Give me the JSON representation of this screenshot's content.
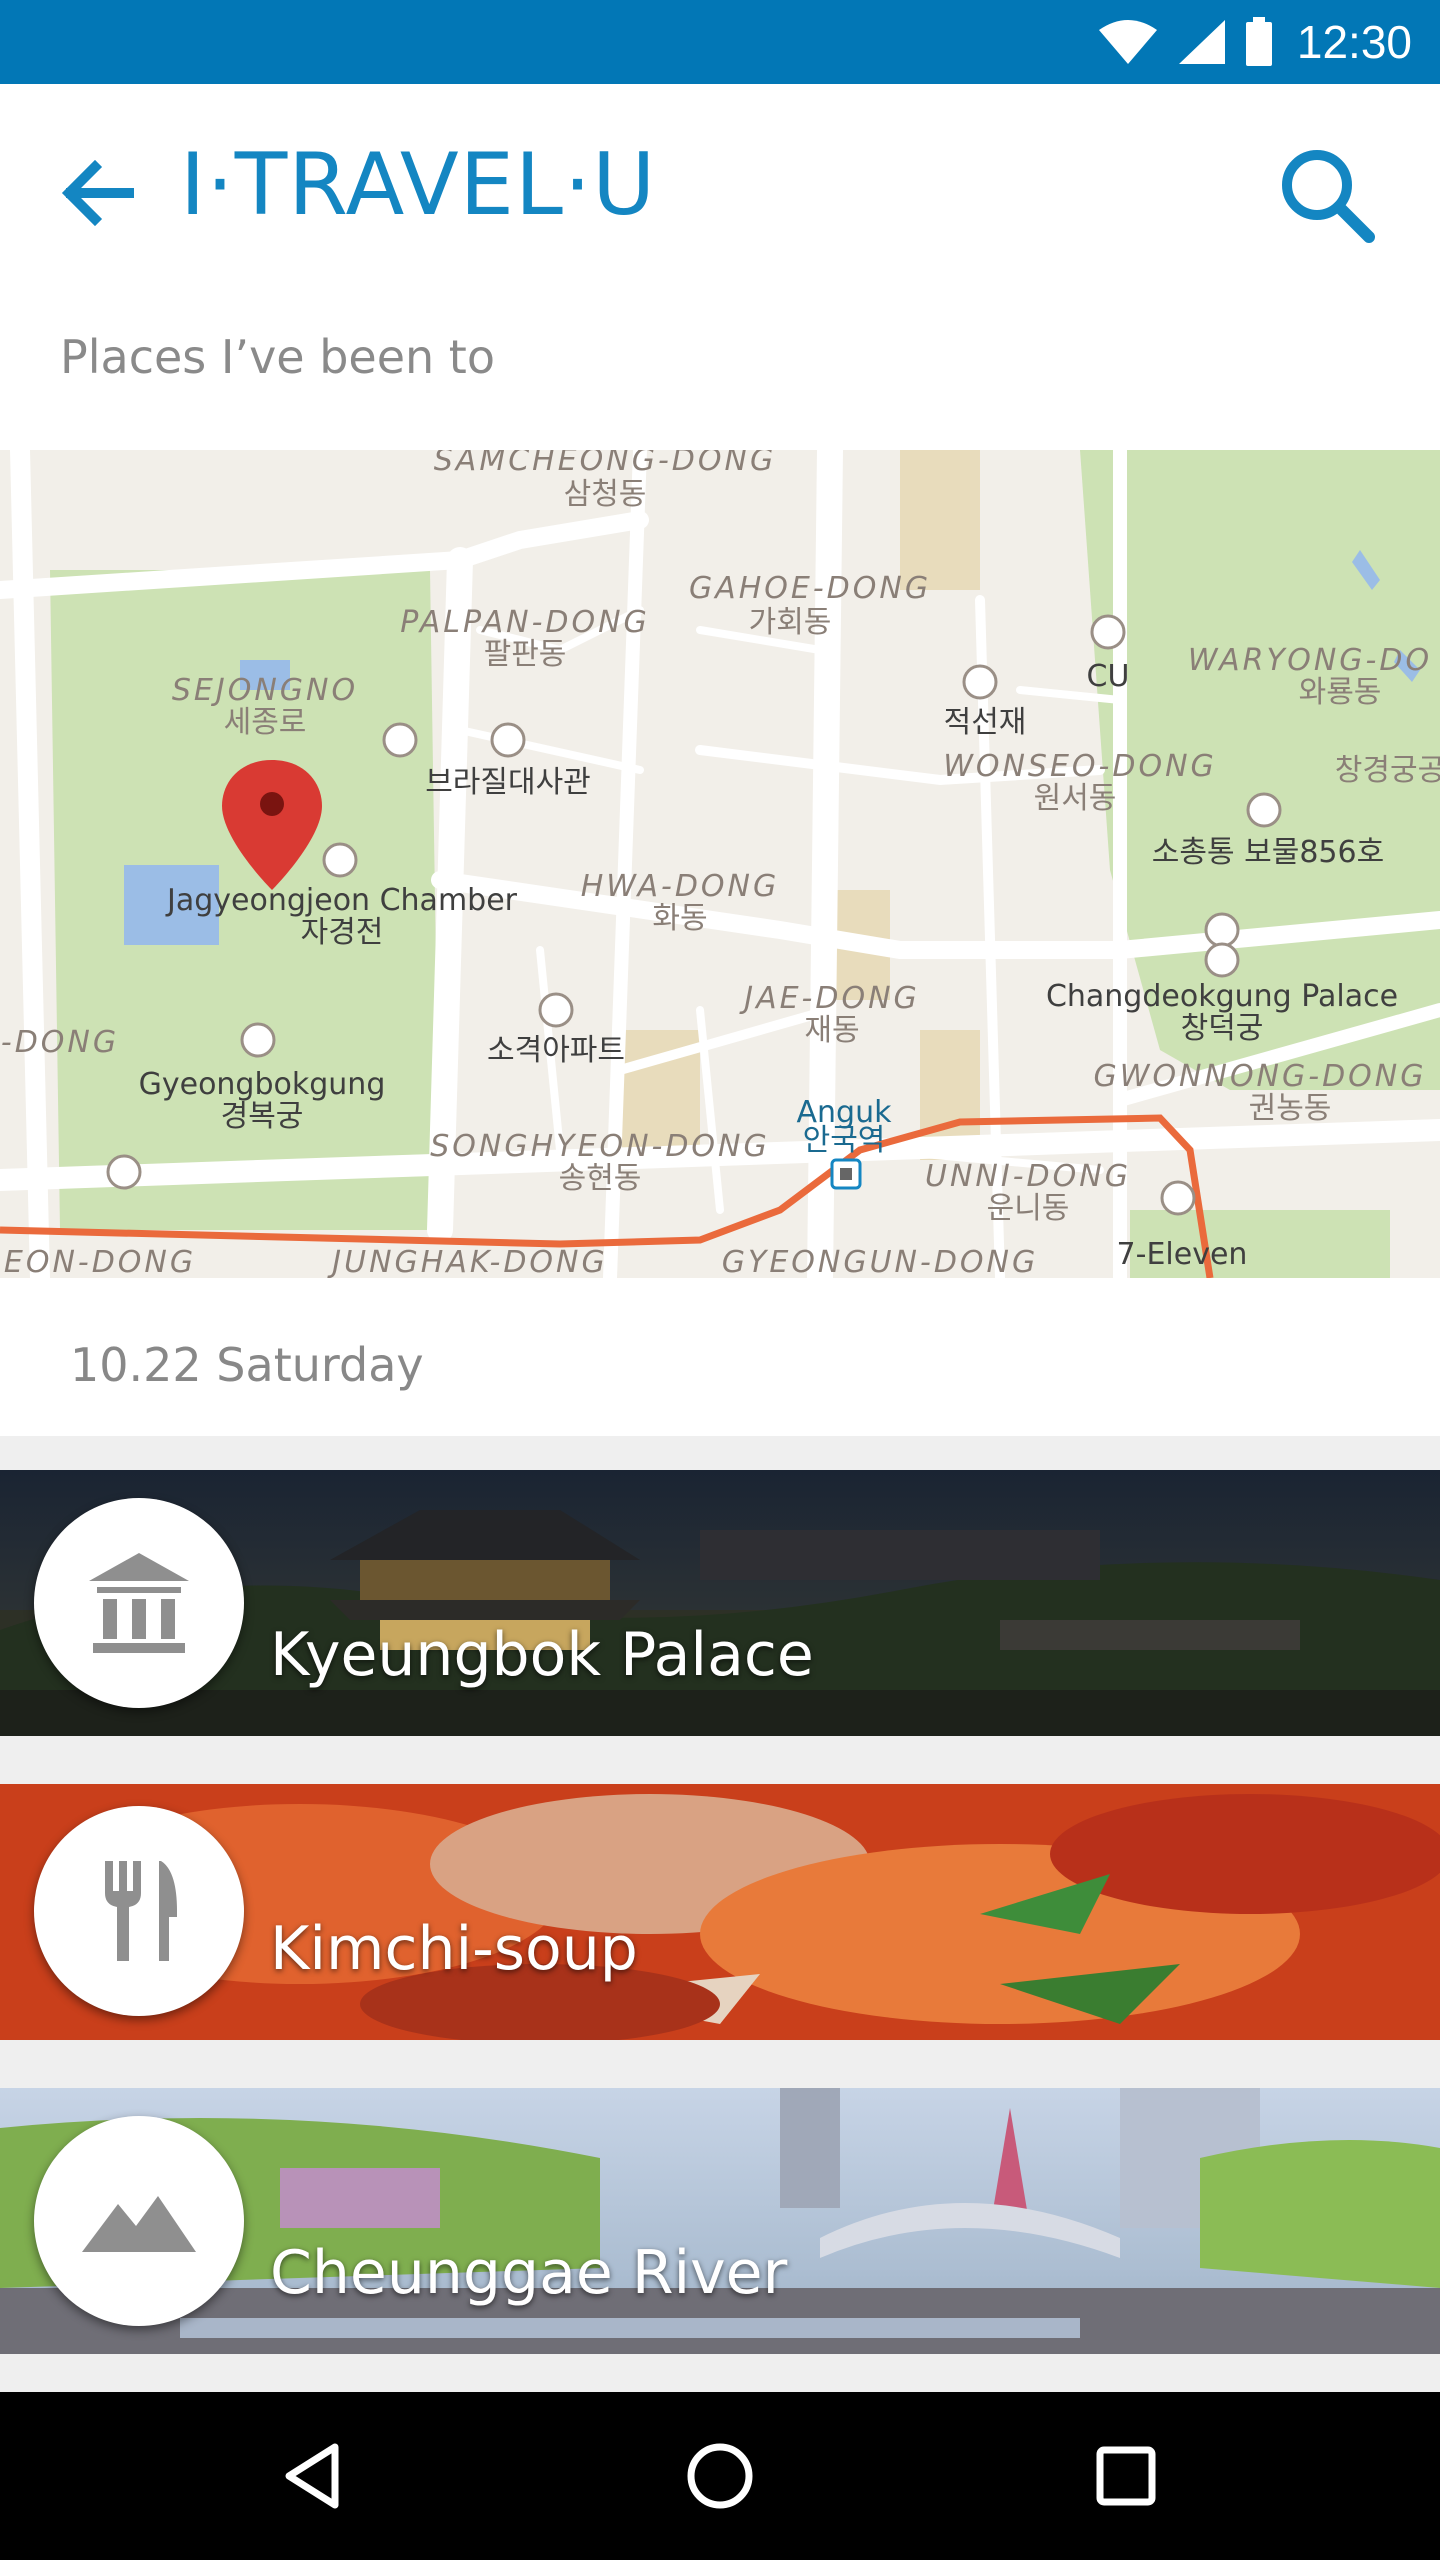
{
  "status_bar": {
    "time": "12:30",
    "bg_color": "#0277b6"
  },
  "app_bar": {
    "title": "I·TRAVEL·U",
    "back_icon": "arrow-back-icon",
    "search_icon": "search-icon",
    "accent_color": "#1486c2"
  },
  "subtitle": "Places I’ve been to",
  "map": {
    "labels": {
      "samcheong_en": "SAMCHEONG-DONG",
      "samcheong_ko": "삼청동",
      "gahoe_en": "GAHOE-DONG",
      "gahoe_ko": "가회동",
      "palpan_en": "PALPAN-DONG",
      "palpan_ko": "팔판동",
      "sejongno_en": "SEJONGNO",
      "sejongno_ko": "세종로",
      "waryong_en": "WARYONG-DO",
      "waryong_ko": "와룡동",
      "cu": "CU",
      "jeokseonjae": "적선재",
      "wonseo_en": "WONSEO-DONG",
      "wonseo_ko": "원서동",
      "changgyeong": "창경궁공",
      "brazil": "브라질대사관",
      "sochong": "소총통 보물856호",
      "jagyeong_en": "Jagyeongjeon Chamber",
      "jagyeong_ko": "자경전",
      "hwa_en": "HWA-DONG",
      "hwa_ko": "화동",
      "jae_en": "JAE-DONG",
      "jae_ko": "재동",
      "changdeok_en": "Changdeokgung Palace",
      "changdeok_ko": "창덕궁",
      "dong_left": "-DONG",
      "sogyeok": "소격아파트",
      "gyeongbok_en": "Gyeongbokgung",
      "gyeongbok_ko": "경복궁",
      "gwonnong_en": "GWONNONG-DONG",
      "gwonnong_ko": "권농동",
      "anguk_en": "Anguk",
      "anguk_ko": "안국역",
      "songhyeon_en": "SONGHYEON-DONG",
      "songhyeon_ko": "송현동",
      "unni_en": "UNNI-DONG",
      "unni_ko": "운니동",
      "seven_eleven": "7-Eleven",
      "bottom_left": "EON-DONG",
      "junghak": "JUNGHAK-DONG",
      "gyeongun": "GYEONGUN-DONG"
    }
  },
  "date": "10.22 Saturday",
  "places": [
    {
      "name": "Kyeungbok Palace",
      "icon": "museum-icon"
    },
    {
      "name": "Kimchi-soup",
      "icon": "restaurant-icon"
    },
    {
      "name": "Cheunggae River",
      "icon": "landscape-icon"
    }
  ],
  "nav": {
    "back": "nav-back-icon",
    "home": "nav-home-icon",
    "recents": "nav-recents-icon"
  }
}
